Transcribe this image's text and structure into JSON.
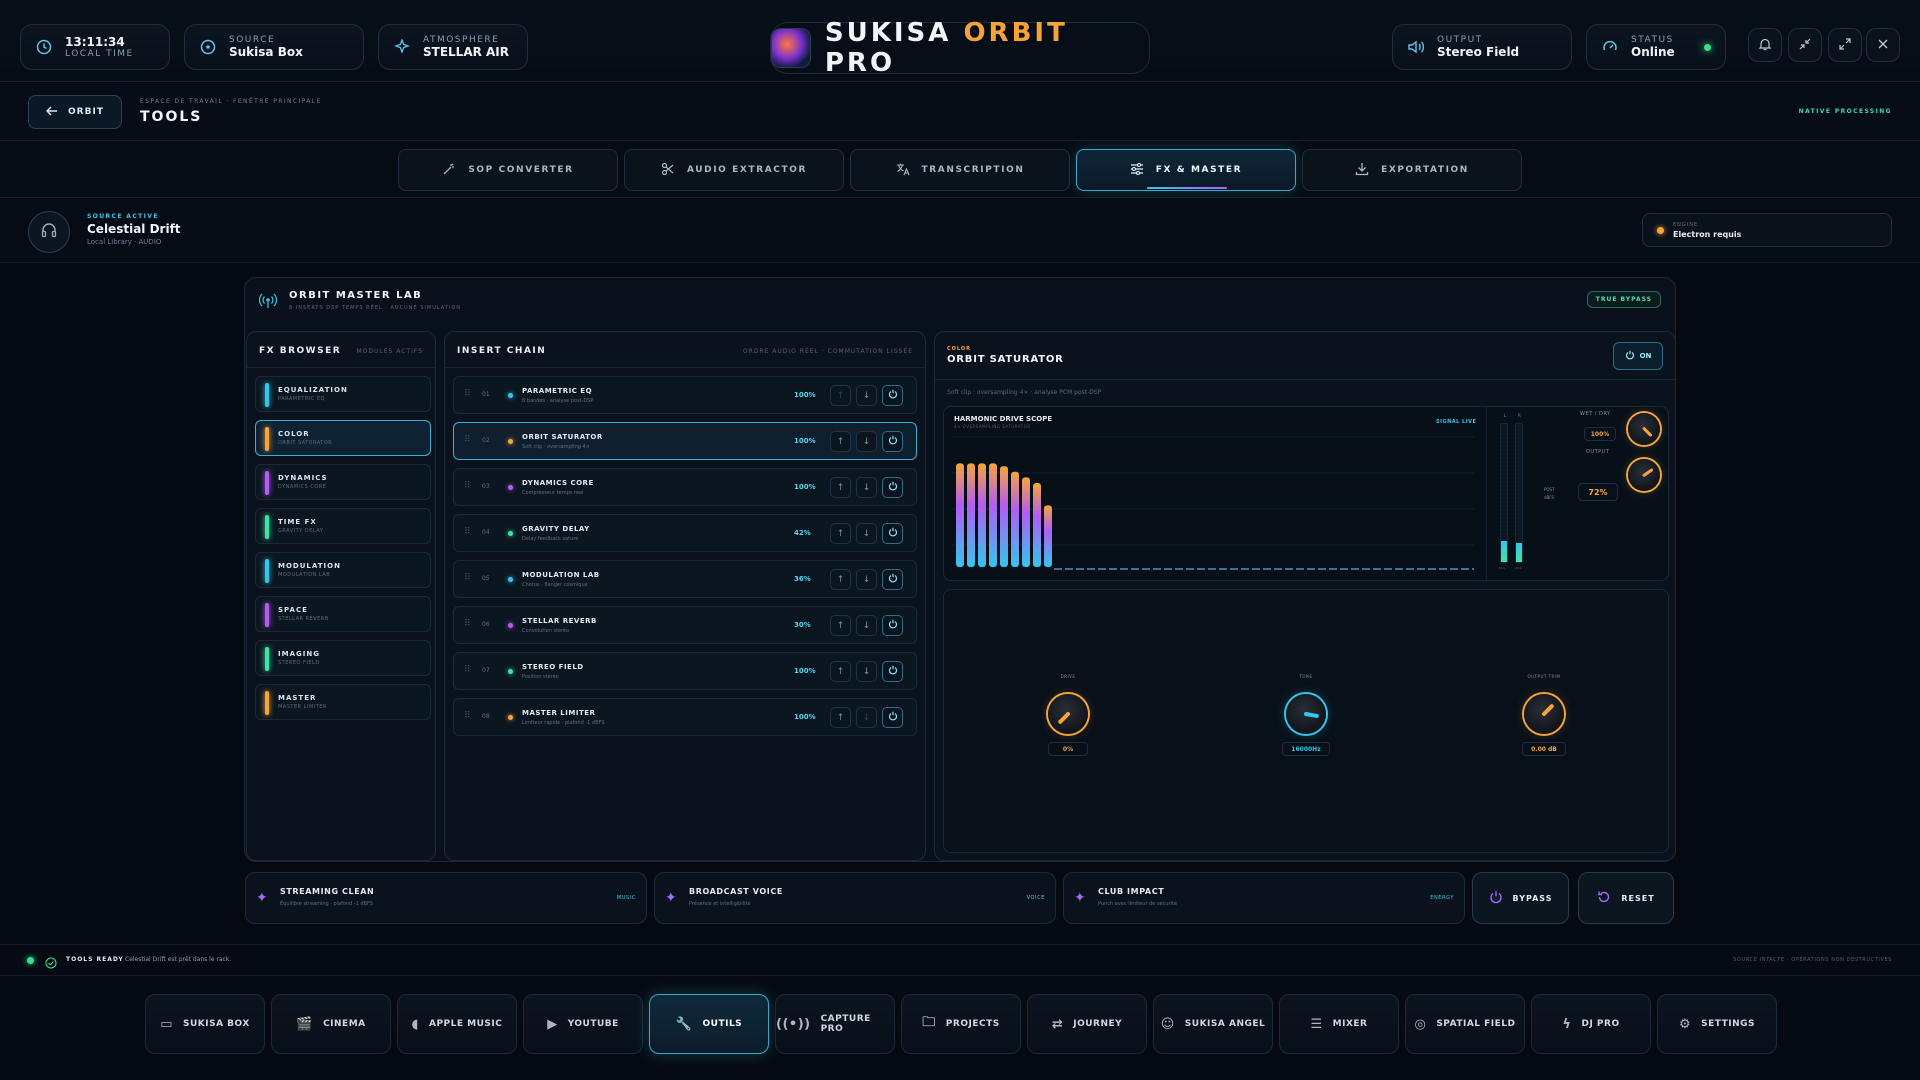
{
  "header": {
    "time": {
      "value": "13:11:34",
      "label": "LOCAL TIME"
    },
    "source": {
      "label": "SOURCE",
      "value": "Sukisa Box"
    },
    "atmosphere": {
      "label": "ATMOSPHERE",
      "value": "STELLAR AIR"
    },
    "brand": {
      "p1": "SUKISA",
      "p2": "ORBIT",
      "p3": "PRO"
    },
    "output": {
      "label": "OUTPUT",
      "value": "Stereo Field"
    },
    "status": {
      "label": "STATUS",
      "value": "Online"
    }
  },
  "subheader": {
    "back_label": "ORBIT",
    "breadcrumb": "ESPACE DE TRAVAIL · FENÊTRE PRINCIPALE",
    "title": "TOOLS",
    "right_label": "NATIVE PROCESSING"
  },
  "tabs": [
    {
      "label": "SOP CONVERTER",
      "icon": "wand-icon"
    },
    {
      "label": "AUDIO EXTRACTOR",
      "icon": "scissors-icon"
    },
    {
      "label": "TRANSCRIPTION",
      "icon": "translate-icon"
    },
    {
      "label": "FX & MASTER",
      "icon": "sliders-icon",
      "active": true
    },
    {
      "label": "EXPORTATION",
      "icon": "download-icon"
    }
  ],
  "source_bar": {
    "kicker": "SOURCE ACTIVE",
    "title": "Celestial Drift",
    "meta": "Local Library · AUDIO",
    "engine_label": "ENGINE",
    "engine_value": "Electron requis"
  },
  "lab": {
    "title": "ORBIT MASTER LAB",
    "subtitle": "8 INSERTS DSP TEMPS RÉEL · AUCUNE SIMULATION",
    "badge": "TRUE BYPASS"
  },
  "fx_browser": {
    "title": "FX BROWSER",
    "meta": "MODULES ACTIFS",
    "items": [
      {
        "name": "EQUALIZATION",
        "desc": "PARAMETRIC EQ",
        "color": "#34c6ec"
      },
      {
        "name": "COLOR",
        "desc": "ORBIT SATURATOR",
        "color": "#f5a53a",
        "active": true
      },
      {
        "name": "DYNAMICS",
        "desc": "DYNAMICS CORE",
        "color": "#b45cf5"
      },
      {
        "name": "TIME FX",
        "desc": "GRAVITY DELAY",
        "color": "#3de4a6"
      },
      {
        "name": "MODULATION",
        "desc": "MODULATION LAB",
        "color": "#34c6ec"
      },
      {
        "name": "SPACE",
        "desc": "STELLAR REVERB",
        "color": "#b45cf5"
      },
      {
        "name": "IMAGING",
        "desc": "STEREO FIELD",
        "color": "#3de4a6"
      },
      {
        "name": "MASTER",
        "desc": "MASTER LIMITER",
        "color": "#f5a53a"
      }
    ]
  },
  "insert_chain": {
    "title": "INSERT CHAIN",
    "meta": "ORDRE AUDIO RÉEL · COMMUTATION LISSÉE",
    "rows": [
      {
        "num": "01",
        "name": "PARAMETRIC EQ",
        "desc": "8 bandes · analyse post-DSP",
        "pct": "100%",
        "dot": "#34c6ec"
      },
      {
        "num": "02",
        "name": "ORBIT SATURATOR",
        "desc": "Soft clip · oversampling 4×",
        "pct": "100%",
        "dot": "#f5a53a",
        "active": true
      },
      {
        "num": "03",
        "name": "DYNAMICS CORE",
        "desc": "Compresseur temps réel",
        "pct": "100%",
        "dot": "#b45cf5"
      },
      {
        "num": "04",
        "name": "GRAVITY DELAY",
        "desc": "Delay feedback saturé",
        "pct": "42%",
        "dot": "#3de4a6"
      },
      {
        "num": "05",
        "name": "MODULATION LAB",
        "desc": "Chorus · flanger cosmique",
        "pct": "36%",
        "dot": "#34c6ec"
      },
      {
        "num": "06",
        "name": "STELLAR REVERB",
        "desc": "Convolution stéréo",
        "pct": "30%",
        "dot": "#b45cf5"
      },
      {
        "num": "07",
        "name": "STEREO FIELD",
        "desc": "Position stéréo",
        "pct": "100%",
        "dot": "#3de4a6"
      },
      {
        "num": "08",
        "name": "MASTER LIMITER",
        "desc": "Limiteur rapide · plafond -1 dBFS",
        "pct": "100%",
        "dot": "#f5a53a"
      }
    ]
  },
  "detail": {
    "kicker": "COLOR",
    "title": "ORBIT SATURATOR",
    "on_label": "ON",
    "desc": "Soft clip · oversampling 4× · analyse PCM post-DSP",
    "scope": {
      "title": "HARMONIC DRIVE SCOPE",
      "subtitle": "4× OVERSAMPLING SATURATOR",
      "live": "SIGNAL LIVE",
      "bar_levels": [
        0.74,
        0.74,
        0.74,
        0.74,
        0.72,
        0.68,
        0.64,
        0.6,
        0.44
      ],
      "meter_labels": {
        "l": "L",
        "r": "R",
        "lv": "-72.0",
        "rv": "-72.0"
      },
      "meter_levels": {
        "l": 0.15,
        "r": 0.14
      }
    },
    "wetdry": {
      "label": "WET / DRY",
      "value": "100%"
    },
    "output": {
      "label": "OUTPUT",
      "value": "72%",
      "post": "POST",
      "unit": "dBFS"
    },
    "knobs": [
      {
        "label": "DRIVE",
        "value": "0%",
        "color": "#f5a53a"
      },
      {
        "label": "TONE",
        "value": "16000Hz",
        "color": "#34c6ec"
      },
      {
        "label": "OUTPUT TRIM",
        "value": "0.00 dB",
        "color": "#f5a53a"
      }
    ]
  },
  "presets": [
    {
      "name": "STREAMING CLEAN",
      "desc": "Équilibre streaming · plafond -1 dBFS",
      "tag": "MUSIC"
    },
    {
      "name": "BROADCAST VOICE",
      "desc": "Présence et intelligibilité",
      "tag": "VOICE"
    },
    {
      "name": "CLUB IMPACT",
      "desc": "Punch avec limiteur de sécurité",
      "tag": "ENERGY"
    }
  ],
  "actions": {
    "bypass": "BYPASS",
    "reset": "RESET"
  },
  "statusbar": {
    "label": "TOOLS READY",
    "message": "Celestial Drift est prêt dans le rack.",
    "right": "SOURCE INTACTE · OPÉRATIONS NON DESTRUCTIVES"
  },
  "nav": [
    {
      "label": "SUKISA BOX",
      "icon": "box-icon"
    },
    {
      "label": "CINEMA",
      "icon": "clapper-icon"
    },
    {
      "label": "APPLE MUSIC",
      "icon": "apple-icon"
    },
    {
      "label": "YOUTUBE",
      "icon": "play-icon"
    },
    {
      "label": "OUTILS",
      "icon": "wrench-icon",
      "active": true
    },
    {
      "label": "CAPTURE PRO",
      "icon": "broadcast-icon"
    },
    {
      "label": "PROJECTS",
      "icon": "folder-icon"
    },
    {
      "label": "JOURNEY",
      "icon": "route-icon"
    },
    {
      "label": "SUKISA ANGEL",
      "icon": "bot-icon"
    },
    {
      "label": "MIXER",
      "icon": "sliders-icon"
    },
    {
      "label": "SPATIAL FIELD",
      "icon": "spatial-icon"
    },
    {
      "label": "DJ PRO",
      "icon": "bolt-icon"
    },
    {
      "label": "SETTINGS",
      "icon": "gear-icon"
    }
  ]
}
